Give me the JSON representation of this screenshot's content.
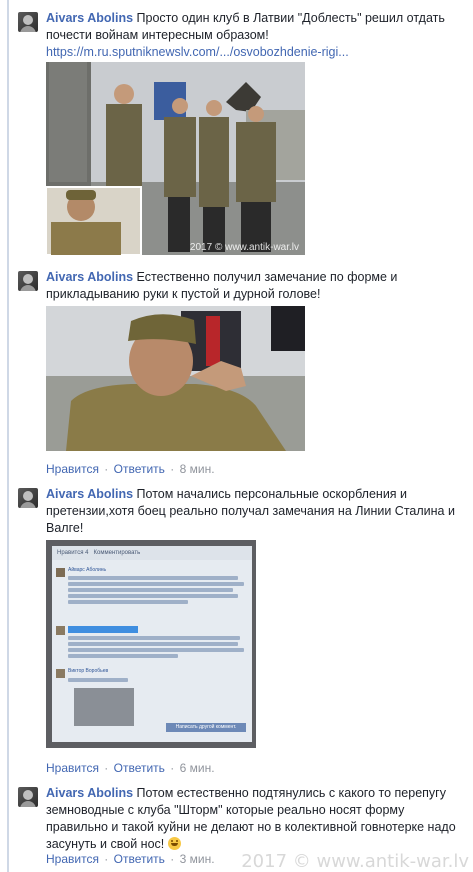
{
  "comments": [
    {
      "author": "Aivars Abolins",
      "text": "Просто один клуб в Латвии \"Доблесть\" решил отдать почести войнам интересным образом!",
      "link": "https://m.ru.sputniknewslv.com/.../osvobozhdenie-rigi...",
      "photo_watermark": "2017 © www.antik-war.lv"
    },
    {
      "author": "Aivars Abolins",
      "text": "Естественно получил замечание по форме и прикладыванию руки к пустой и дурной голове!",
      "like_label": "Нравится",
      "reply_label": "Ответить",
      "time": "8 мин."
    },
    {
      "author": "Aivars Abolins",
      "text": "Потом начались персональные оскорбления и претензии,хотя боец реально получал замечания на Линии Сталина и Валге!",
      "screenshot": {
        "like": "Нравится",
        "count": "4",
        "comment": "Комментировать",
        "name1": "Айварс Аболинь",
        "name2": "Виктор Воробьев",
        "reply_btn": "Написать другой коммент."
      },
      "like_label": "Нравится",
      "reply_label": "Ответить",
      "time": "6 мин."
    },
    {
      "author": "Aivars Abolins",
      "text": "Потом естественно подтянулись с какого то перепугу земноводные с клуба \"Шторм\" которые реально носят форму правильно и такой куйни не делают но в колективной говнотерке надо засунуть и свой нос!",
      "like_label": "Нравится",
      "reply_label": "Ответить",
      "time": "3 мин."
    }
  ],
  "page_watermark": "2017 © www.antik-war.lv"
}
